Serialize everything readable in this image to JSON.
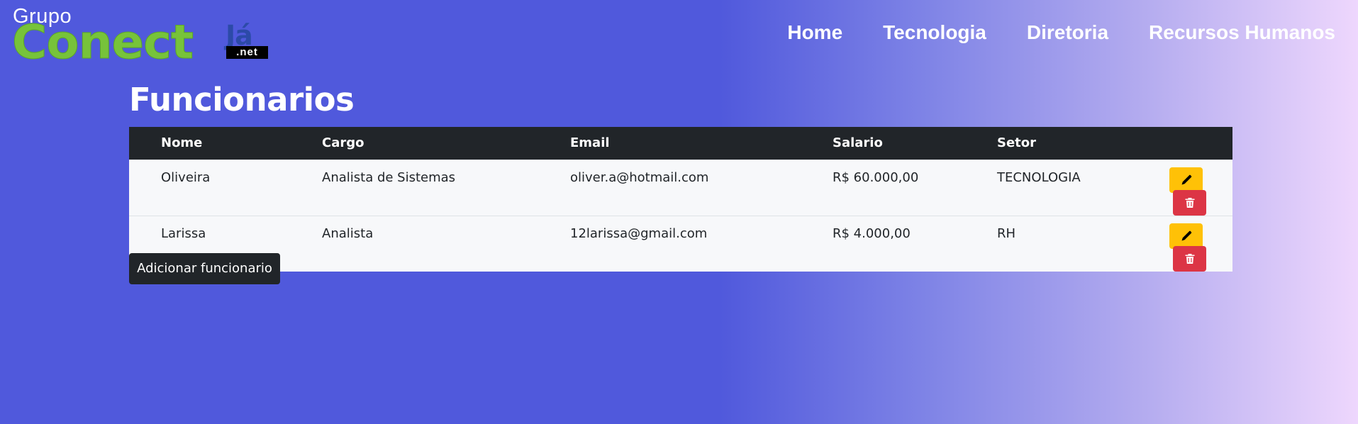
{
  "logo": {
    "line1": "Grupo",
    "brand": "Conect",
    "suffix": "Já",
    "domain": ".net"
  },
  "nav": {
    "items": [
      {
        "label": "Home"
      },
      {
        "label": "Tecnologia"
      },
      {
        "label": "Diretoria"
      },
      {
        "label": "Recursos Humanos"
      }
    ]
  },
  "page": {
    "title": "Funcionarios"
  },
  "table": {
    "headers": [
      "Nome",
      "Cargo",
      "Email",
      "Salario",
      "Setor"
    ],
    "rows": [
      {
        "nome": "Oliveira",
        "cargo": "Analista de Sistemas",
        "email": "oliver.a@hotmail.com",
        "salario": "R$ 60.000,00",
        "setor": "TECNOLOGIA"
      },
      {
        "nome": "Larissa",
        "cargo": "Analista",
        "email": "12larissa@gmail.com",
        "salario": "R$ 4.000,00",
        "setor": "RH"
      }
    ]
  },
  "actions": {
    "add_label": "Adicionar funcionario",
    "edit_icon": "pencil-icon",
    "delete_icon": "trash-icon"
  },
  "colors": {
    "edit": "#ffc107",
    "delete": "#dc3545",
    "dark": "#212529",
    "brand_green": "#77c33a",
    "brand_blue": "#2c4aa8"
  }
}
